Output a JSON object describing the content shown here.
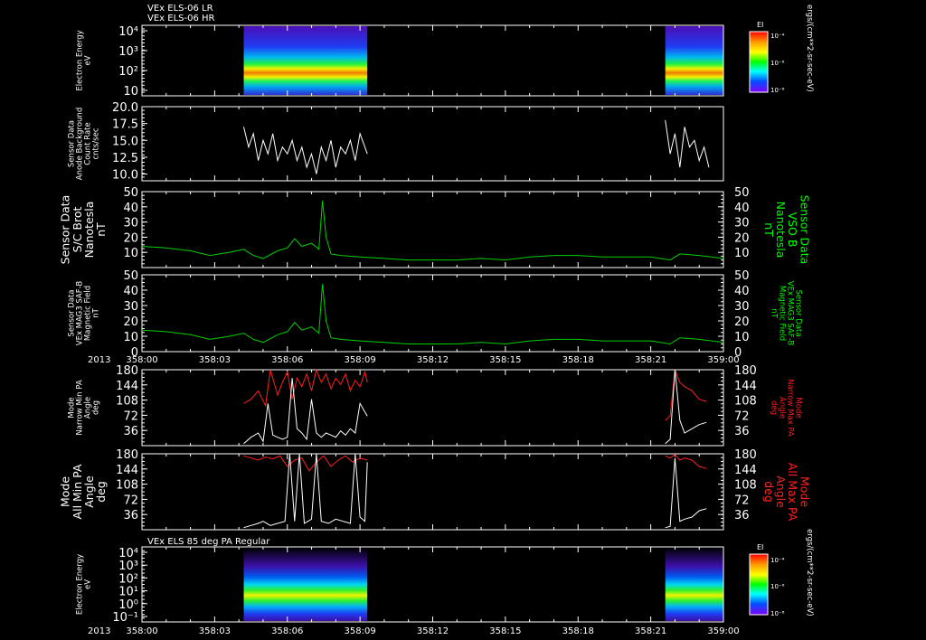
{
  "colors": {
    "background": "#000000",
    "axis": "#ffffff",
    "text": "#ffffff",
    "green_series": "#00d000",
    "green_label": "#00ff00",
    "red_series": "#ff2020",
    "red_label": "#ff2020",
    "white_series": "#ffffff"
  },
  "header": {
    "title_line1": "VEx ELS-06 LR",
    "title_line2": "VEx ELS-06 HR"
  },
  "time_axis": {
    "year_label": "2013",
    "ticks": [
      "358:00",
      "358:03",
      "358:06",
      "358:09",
      "358:12",
      "358:15",
      "358:18",
      "358:21",
      "359:00"
    ]
  },
  "chart_data": [
    {
      "id": "p1",
      "type": "heatmap",
      "ylabel": [
        "Electron Energy",
        "eV"
      ],
      "ytick_labels": [
        "10⁴",
        "10³",
        "10²",
        "10"
      ],
      "colorbar": {
        "title": "EI",
        "tick_labels": [
          "10⁻⁴",
          "10⁻⁶",
          "10⁻⁸"
        ],
        "units": "ergs/(cm**2-sr-sec-eV)"
      },
      "data_intervals": [
        [
          "358:04.2",
          "358:09.3"
        ],
        [
          "358:21.6",
          "359:00"
        ]
      ]
    },
    {
      "id": "p2",
      "type": "line",
      "ylabel": [
        "Sensor Data",
        "Anode Background",
        "Count Rate",
        "cnts/sec"
      ],
      "ylim": [
        9.0,
        20.0
      ],
      "ytick_labels": [
        "20.0",
        "17.5",
        "15.0",
        "12.5",
        "10.0"
      ],
      "series": [
        {
          "color": "white",
          "segments": [
            {
              "x": [
                4.2,
                4.4,
                4.6,
                4.8,
                5.0,
                5.2,
                5.4,
                5.6,
                5.8,
                6.0,
                6.2,
                6.4,
                6.6,
                6.8,
                7.0,
                7.2,
                7.4,
                7.6,
                7.8,
                8.0,
                8.2,
                8.4,
                8.6,
                8.8,
                9.0,
                9.2,
                9.3
              ],
              "y": [
                17,
                14,
                16,
                12,
                15,
                13,
                16,
                12,
                14,
                13,
                15,
                12,
                14,
                11,
                13,
                10,
                14,
                12,
                15,
                11,
                14,
                13,
                15,
                12,
                16,
                14,
                13
              ]
            },
            {
              "x": [
                21.6,
                21.8,
                22.0,
                22.2,
                22.4,
                22.6,
                22.8,
                23.0,
                23.2,
                23.4
              ],
              "y": [
                18,
                13,
                16,
                11,
                17,
                14,
                15,
                12,
                14,
                11
              ]
            }
          ]
        }
      ]
    },
    {
      "id": "p3",
      "type": "line",
      "ylabel": [
        "Sensor Data",
        "S/C Brot",
        "Nanotesla",
        "nT"
      ],
      "right_label": [
        "Sensor Data",
        "VSO B",
        "Nanotesla",
        "nT"
      ],
      "ylim": [
        0,
        50
      ],
      "ytick_labels": [
        "50",
        "40",
        "30",
        "20",
        "10"
      ],
      "series": [
        {
          "color": "green",
          "x": [
            0,
            1.0,
            2.0,
            2.8,
            3.2,
            3.6,
            4.2,
            4.6,
            5.0,
            5.6,
            6.0,
            6.3,
            6.6,
            7.0,
            7.3,
            7.45,
            7.6,
            7.8,
            8.2,
            9.0,
            10,
            11,
            12,
            13,
            14,
            15,
            16,
            17,
            18,
            19,
            20,
            21,
            21.8,
            22.2,
            23,
            24
          ],
          "y": [
            14,
            13,
            11,
            8,
            9,
            10,
            12,
            8,
            6,
            11,
            13,
            19,
            14,
            16,
            12,
            44,
            20,
            9,
            8,
            7,
            6,
            5,
            5,
            5,
            6,
            5,
            7,
            8,
            8,
            7,
            7,
            7,
            5,
            9,
            8,
            6
          ]
        }
      ]
    },
    {
      "id": "p4",
      "type": "line",
      "ylabel": [
        "Sensor Data",
        "VEx MAG3 SAF-B",
        "Magnetic Field",
        "nT"
      ],
      "right_label": [
        "Sensor Data",
        "VEx MAG3 SAF-B",
        "Magnetic Field",
        "nT"
      ],
      "ylim": [
        0,
        50
      ],
      "ytick_labels": [
        "50",
        "40",
        "30",
        "20",
        "10",
        "0"
      ],
      "series": [
        {
          "color": "green",
          "x": [
            0,
            1.0,
            2.0,
            2.8,
            3.2,
            3.6,
            4.2,
            4.6,
            5.0,
            5.6,
            6.0,
            6.3,
            6.6,
            7.0,
            7.3,
            7.45,
            7.6,
            7.8,
            8.2,
            9.0,
            10,
            11,
            12,
            13,
            14,
            15,
            16,
            17,
            18,
            19,
            20,
            21,
            21.8,
            22.2,
            23,
            24
          ],
          "y": [
            14,
            13,
            11,
            8,
            9,
            10,
            12,
            8,
            6,
            11,
            13,
            19,
            14,
            16,
            12,
            44,
            20,
            9,
            8,
            7,
            6,
            5,
            5,
            5,
            6,
            5,
            7,
            8,
            8,
            7,
            7,
            7,
            5,
            9,
            8,
            6
          ]
        }
      ]
    },
    {
      "id": "p5",
      "type": "line",
      "ylabel": [
        "Mode",
        "Narrow Min PA",
        "Angle",
        "deg"
      ],
      "right_label": [
        "Mode",
        "Narrow Max PA",
        "Angle",
        "deg"
      ],
      "ylim": [
        0,
        180
      ],
      "ytick_labels": [
        "180",
        "144",
        "108",
        "72",
        "36"
      ],
      "series": [
        {
          "color": "red",
          "segments": [
            {
              "x": [
                4.2,
                4.5,
                4.8,
                5.1,
                5.3,
                5.6,
                5.8,
                6.0,
                6.2,
                6.4,
                6.6,
                6.8,
                7.0,
                7.2,
                7.4,
                7.6,
                7.8,
                8.0,
                8.2,
                8.4,
                8.6,
                8.8,
                9.0,
                9.2,
                9.3
              ],
              "y": [
                100,
                110,
                130,
                95,
                180,
                120,
                150,
                175,
                110,
                160,
                140,
                170,
                130,
                180,
                150,
                170,
                135,
                160,
                145,
                170,
                130,
                155,
                140,
                175,
                150
              ]
            },
            {
              "x": [
                21.6,
                21.8,
                22.0,
                22.2,
                22.4,
                22.7,
                23.0,
                23.3
              ],
              "y": [
                60,
                70,
                180,
                150,
                140,
                130,
                110,
                105
              ]
            }
          ]
        },
        {
          "color": "white",
          "segments": [
            {
              "x": [
                4.2,
                4.5,
                4.8,
                5.0,
                5.2,
                5.4,
                5.6,
                5.8,
                6.0,
                6.2,
                6.4,
                6.6,
                6.8,
                7.0,
                7.2,
                7.4,
                7.6,
                7.8,
                8.0,
                8.2,
                8.4,
                8.6,
                8.8,
                9.0,
                9.2,
                9.3
              ],
              "y": [
                5,
                20,
                30,
                10,
                100,
                25,
                20,
                15,
                20,
                160,
                40,
                30,
                15,
                110,
                30,
                20,
                30,
                25,
                20,
                35,
                25,
                40,
                30,
                100,
                80,
                70
              ]
            },
            {
              "x": [
                21.6,
                21.8,
                22.0,
                22.2,
                22.4,
                22.7,
                23.0,
                23.3
              ],
              "y": [
                5,
                15,
                180,
                60,
                30,
                40,
                50,
                55
              ]
            }
          ]
        }
      ]
    },
    {
      "id": "p6",
      "type": "line",
      "ylabel": [
        "Mode",
        "All Min PA",
        "Angle",
        "deg"
      ],
      "right_label": [
        "Mode",
        "All Max PA",
        "Angle",
        "deg"
      ],
      "ylim": [
        0,
        180
      ],
      "ytick_labels": [
        "180",
        "144",
        "108",
        "72",
        "36"
      ],
      "series": [
        {
          "color": "red",
          "segments": [
            {
              "x": [
                4.2,
                4.5,
                4.8,
                5.1,
                5.4,
                5.7,
                6.0,
                6.3,
                6.6,
                6.9,
                7.2,
                7.5,
                7.8,
                8.1,
                8.4,
                8.7,
                9.0,
                9.3
              ],
              "y": [
                175,
                170,
                165,
                172,
                168,
                175,
                150,
                165,
                170,
                140,
                160,
                175,
                150,
                165,
                175,
                160,
                170,
                165
              ]
            },
            {
              "x": [
                21.6,
                21.8,
                22.0,
                22.2,
                22.4,
                22.7,
                23.0,
                23.3
              ],
              "y": [
                175,
                170,
                178,
                165,
                170,
                165,
                150,
                145
              ]
            }
          ]
        },
        {
          "color": "white",
          "segments": [
            {
              "x": [
                4.2,
                4.5,
                4.8,
                5.0,
                5.3,
                5.6,
                5.9,
                6.1,
                6.3,
                6.5,
                6.7,
                7.0,
                7.2,
                7.4,
                7.7,
                8.0,
                8.3,
                8.6,
                8.8,
                9.0,
                9.2,
                9.3
              ],
              "y": [
                5,
                10,
                15,
                20,
                10,
                15,
                20,
                180,
                20,
                180,
                15,
                25,
                180,
                20,
                15,
                25,
                20,
                15,
                180,
                30,
                20,
                160
              ]
            },
            {
              "x": [
                21.6,
                21.8,
                22.0,
                22.2,
                22.4,
                22.7,
                23.0,
                23.3
              ],
              "y": [
                5,
                8,
                170,
                20,
                25,
                30,
                45,
                50
              ]
            }
          ]
        }
      ]
    },
    {
      "id": "p7",
      "type": "heatmap",
      "title": "VEx ELS 85 deg PA Regular",
      "ylabel": [
        "Electron Energy",
        "eV"
      ],
      "ytick_labels": [
        "10⁴",
        "10³",
        "10²",
        "10¹",
        "10⁰",
        "10⁻¹"
      ],
      "colorbar": {
        "title": "EI",
        "tick_labels": [
          "10⁻⁴",
          "10⁻⁶",
          "10⁻⁸"
        ],
        "units": "ergs/(cm**2-sr-sec-eV)"
      },
      "data_intervals": [
        [
          "358:04.2",
          "358:09.3"
        ],
        [
          "358:21.6",
          "359:00"
        ]
      ]
    }
  ]
}
